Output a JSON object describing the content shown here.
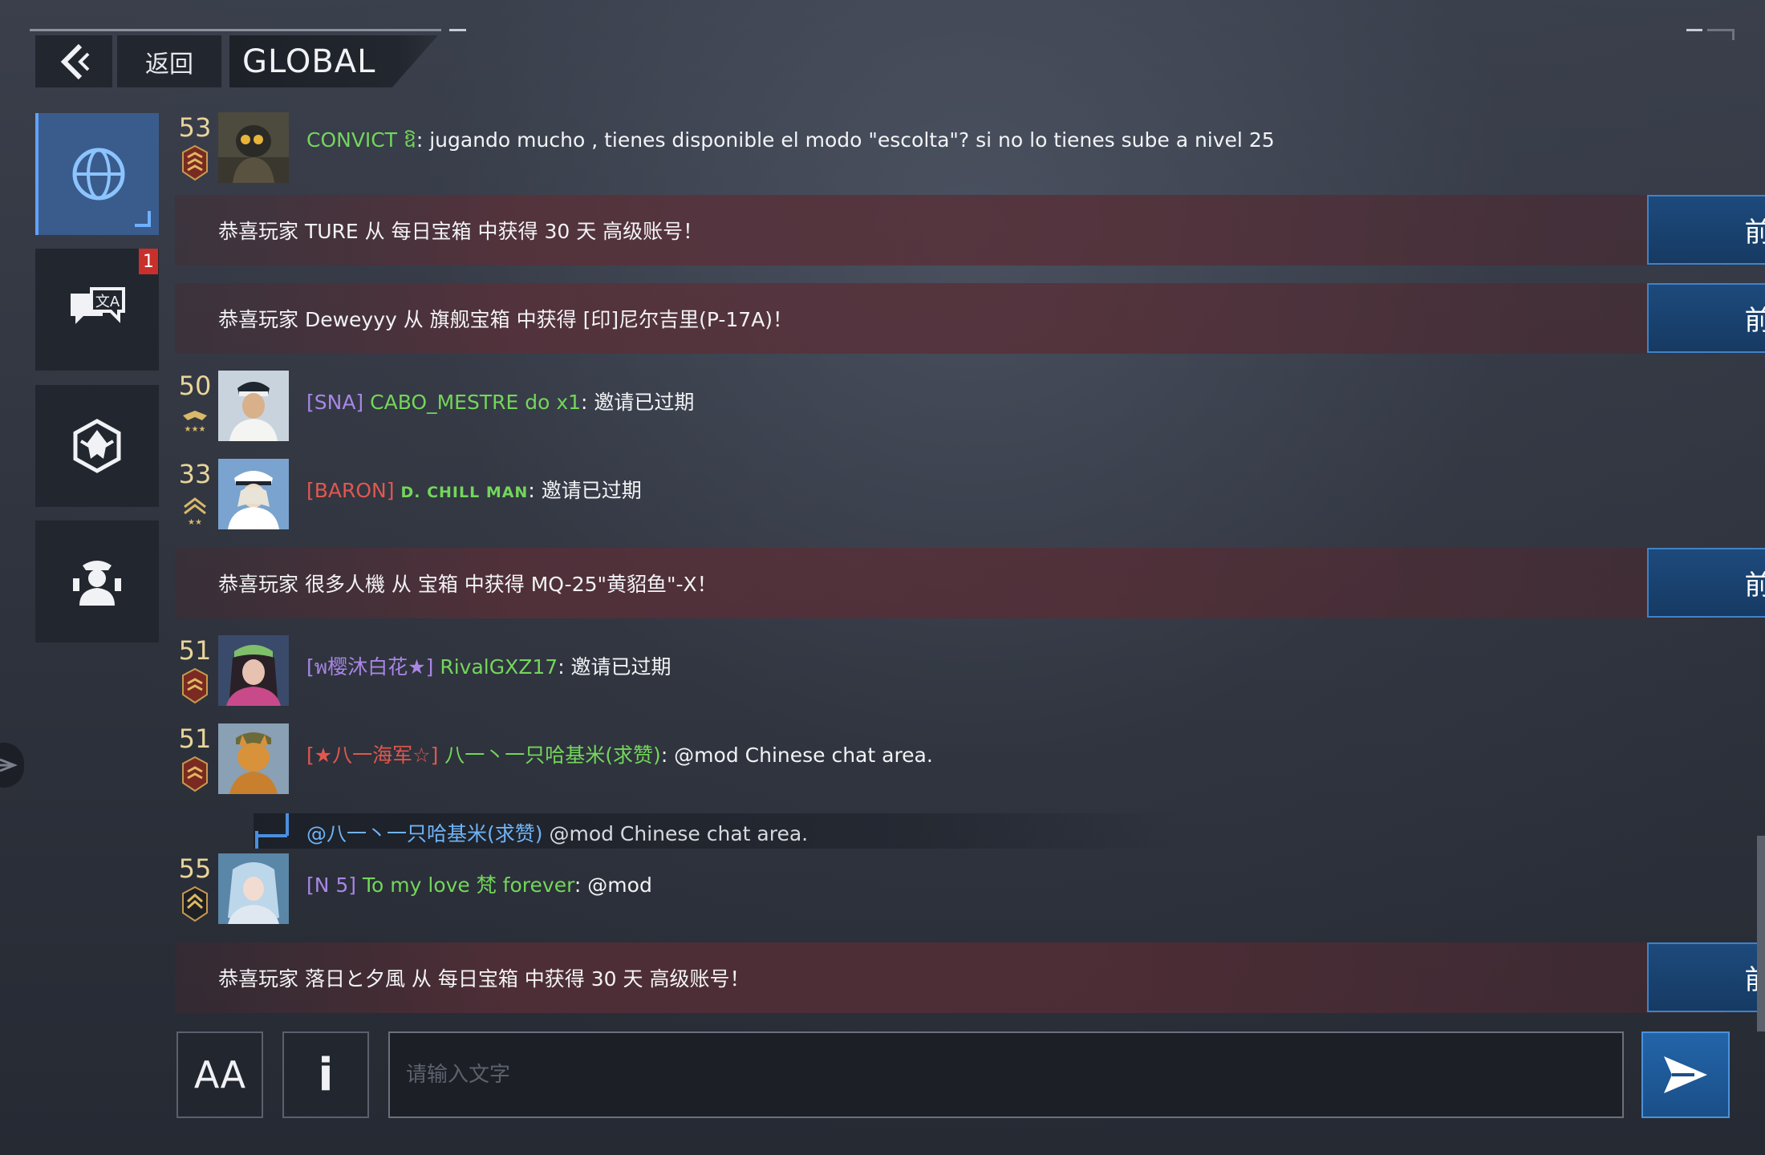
{
  "header": {
    "back_label": "返回",
    "title": "GLOBAL"
  },
  "sidebar": {
    "items": [
      {
        "icon": "globe-icon",
        "active": true
      },
      {
        "icon": "translate-chat-icon",
        "badge": "1"
      },
      {
        "icon": "alliance-emblem-icon"
      },
      {
        "icon": "friends-soldier-icon"
      }
    ]
  },
  "messages": [
    {
      "type": "chat",
      "level": "53",
      "name": "CONVICT ឱ",
      "text": ": jugando mucho , tienes disponible el modo \"escolta\"? si no lo tienes sube a nivel 25"
    },
    {
      "type": "system",
      "text": "恭喜玩家 TURE 从 每日宝箱 中获得 30 天 高级账号！",
      "button": "前往"
    },
    {
      "type": "system",
      "text": "恭喜玩家 Deweyyy 从 旗舰宝箱 中获得 [印]尼尔吉里(P-17A)！",
      "button": "前往"
    },
    {
      "type": "chat",
      "level": "50",
      "tag": "[SNA]",
      "name": "CABO_MESTRE do x1",
      "text": ": 邀请已过期"
    },
    {
      "type": "chat",
      "level": "33",
      "tag": "[BARON]",
      "name": "D. CHILL MAN",
      "text": ": 邀请已过期"
    },
    {
      "type": "system",
      "text": "恭喜玩家 很多人機 从 宝箱 中获得 MQ-25\"黄貂鱼\"-X！",
      "button": "前往"
    },
    {
      "type": "chat",
      "level": "51",
      "tag": "[พ樱沐白花★]",
      "name": "RivalGXZ17",
      "text": ": 邀请已过期"
    },
    {
      "type": "chat",
      "level": "51",
      "tag": "[★八一海军☆]",
      "name": "八一丶一只哈基米(求赞)",
      "text": ": @mod Chinese chat area."
    },
    {
      "type": "reply",
      "mention": "@八一丶一只哈基米(求赞)",
      "text": " @mod Chinese chat area."
    },
    {
      "type": "chat",
      "level": "55",
      "tag": "[N 5]",
      "name": "To my love 梵 forever",
      "text": ": @mod"
    },
    {
      "type": "system",
      "text": "恭喜玩家 落日と夕風 从 每日宝箱 中获得 30 天 高级账号！",
      "button": "前往"
    }
  ],
  "input": {
    "font_button": "AA",
    "info_button": "i",
    "placeholder": "请输入文字"
  },
  "colors": {
    "accent_blue": "#3f83c8",
    "name_green": "#73d65a",
    "tag_purple": "#a886e6",
    "tag_red": "#e0584f",
    "tag_blue": "#6fb3f5",
    "level_gold": "#e8d59a",
    "badge_red": "#c9302c"
  }
}
